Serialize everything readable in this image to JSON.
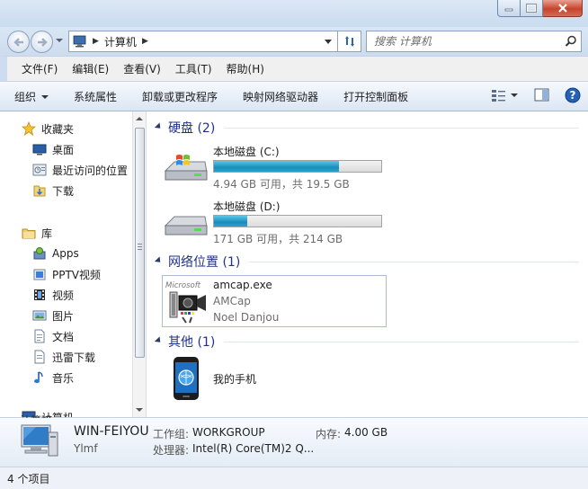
{
  "window": {
    "accent": "#1e3287",
    "close_color": "#c7442b"
  },
  "address": {
    "location": "计算机",
    "separator": "▶"
  },
  "search": {
    "placeholder": "搜索 计算机"
  },
  "menu": [
    "文件(F)",
    "编辑(E)",
    "查看(V)",
    "工具(T)",
    "帮助(H)"
  ],
  "toolbar": {
    "organize": "组织",
    "items": [
      "系统属性",
      "卸载或更改程序",
      "映射网络驱动器",
      "打开控制面板"
    ]
  },
  "nav": {
    "favorites": "收藏夹",
    "favorites_items": [
      "桌面",
      "最近访问的位置",
      "下载"
    ],
    "libraries": "库",
    "library_items": [
      "Apps",
      "PPTV视频",
      "视频",
      "图片",
      "文档",
      "迅雷下载",
      "音乐"
    ],
    "computer": "计算机"
  },
  "groups": {
    "hdd": "硬盘 (2)",
    "network": "网络位置 (1)",
    "other": "其他 (1)"
  },
  "drives": [
    {
      "name": "本地磁盘 (C:)",
      "info": "4.94 GB 可用，共 19.5 GB",
      "used_fraction": 0.747
    },
    {
      "name": "本地磁盘 (D:)",
      "info": "171 GB 可用，共 214 GB",
      "used_fraction": 0.2
    }
  ],
  "network_item": {
    "title": "amcap.exe",
    "line2": "AMCap",
    "line3": "Noel Danjou",
    "logo_text": "Microsoft"
  },
  "other_item": {
    "name": "我的手机"
  },
  "details": {
    "computer_name": "WIN-FEIYOU",
    "workgroup_label": "工作组:",
    "workgroup": "WORKGROUP",
    "memory_label": "内存:",
    "memory": "4.00 GB",
    "user": "Ylmf",
    "processor_label": "处理器:",
    "processor": "Intel(R) Core(TM)2 Q..."
  },
  "status": {
    "count": "4 个项目"
  }
}
